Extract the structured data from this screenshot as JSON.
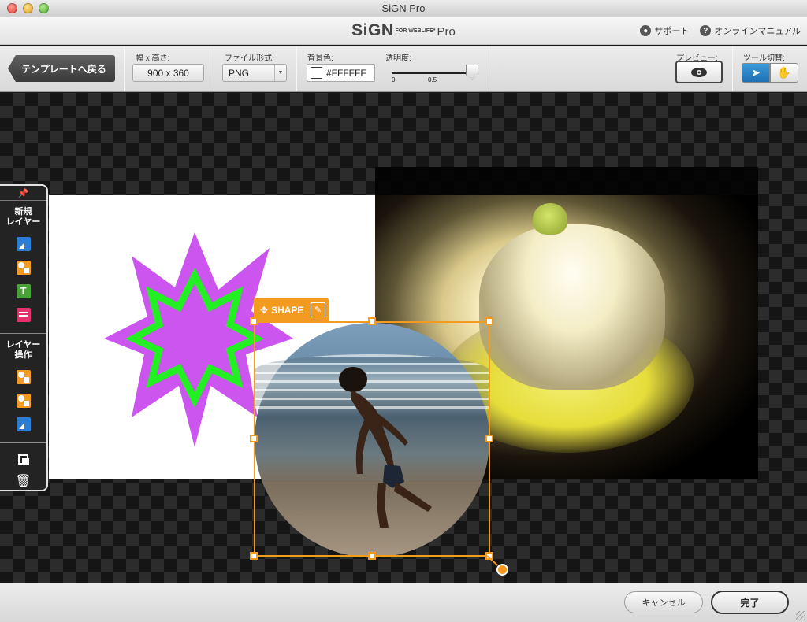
{
  "window": {
    "title": "SiGN Pro"
  },
  "brand": {
    "name": "SiGN",
    "sub": "FOR WEBLIFE*",
    "edition": "Pro"
  },
  "header_links": {
    "support": "サポート",
    "manual": "オンラインマニュアル"
  },
  "toolbar": {
    "back_label": "テンプレートへ戻る",
    "size_label": "幅 x 高さ:",
    "size_value": "900 x 360",
    "format_label": "ファイル形式:",
    "format_value": "PNG",
    "bgcolor_label": "背景色:",
    "bgcolor_value": "#FFFFFF",
    "opacity_label": "透明度:",
    "opacity_value": 1.0,
    "opacity_tick_min": "0",
    "opacity_tick_mid": "0.5",
    "preview_label": "プレビュー:",
    "tool_switch_label": "ツール切替:"
  },
  "left_panel": {
    "new_layer_label": "新規\nレイヤー",
    "layer_ops_label": "レイヤー\n操作"
  },
  "selection": {
    "tag_label": "SHAPE"
  },
  "footer": {
    "cancel_label": "キャンセル",
    "done_label": "完了"
  },
  "colors": {
    "accent": "#f39a21",
    "star_outer": "#cc55f0",
    "star_inner": "#22f022",
    "select_blue": "#2b82cc"
  },
  "icons": [
    "user-icon",
    "help-icon",
    "eye-icon",
    "arrow-pointer-icon",
    "hand-icon",
    "pin-icon",
    "image-layer-icon",
    "shape-layer-icon",
    "text-layer-icon",
    "table-layer-icon",
    "move-icon",
    "pencil-icon",
    "copy-icon",
    "trash-icon"
  ]
}
